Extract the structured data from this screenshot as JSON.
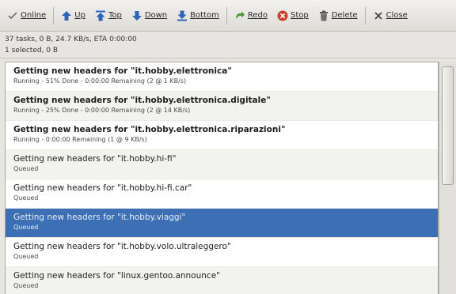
{
  "toolbar": {
    "online": "Online",
    "up": "Up",
    "top": "Top",
    "down": "Down",
    "bottom": "Bottom",
    "redo": "Redo",
    "stop": "Stop",
    "delete": "Delete",
    "close": "Close"
  },
  "status": {
    "summary": "37 tasks, 0 B, 24.7 KB/s, ETA 0:00:00",
    "selection": "1 selected, 0 B"
  },
  "tasks": [
    {
      "title": "Getting new headers for \"it.hobby.elettronica\"",
      "detail": "Running - 51% Done - 0:00:00 Remaining (2 @ 1 KB/s)",
      "bold": true
    },
    {
      "title": "Getting new headers for \"it.hobby.elettronica.digitale\"",
      "detail": "Running - 25% Done - 0:00:00 Remaining (2 @ 14 KB/s)",
      "bold": true
    },
    {
      "title": "Getting new headers for \"it.hobby.elettronica.riparazioni\"",
      "detail": "Running - 0:00:00 Remaining (1 @ 9 KB/s)",
      "bold": true
    },
    {
      "title": "Getting new headers for \"it.hobby.hi-fi\"",
      "detail": "Queued",
      "bold": false
    },
    {
      "title": "Getting new headers for \"it.hobby.hi-fi.car\"",
      "detail": "Queued",
      "bold": false
    },
    {
      "title": "Getting new headers for \"it.hobby.viaggi\"",
      "detail": "Queued",
      "bold": false,
      "selected": true
    },
    {
      "title": "Getting new headers for \"it.hobby.volo.ultraleggero\"",
      "detail": "Queued",
      "bold": false
    },
    {
      "title": "Getting new headers for \"linux.gentoo.announce\"",
      "detail": "Queued",
      "bold": false
    }
  ],
  "colors": {
    "selection": "#3c6fb4",
    "stop_icon": "#d0392b",
    "arrow_icon": "#2e64b8",
    "redo_icon": "#4a9a2e"
  }
}
